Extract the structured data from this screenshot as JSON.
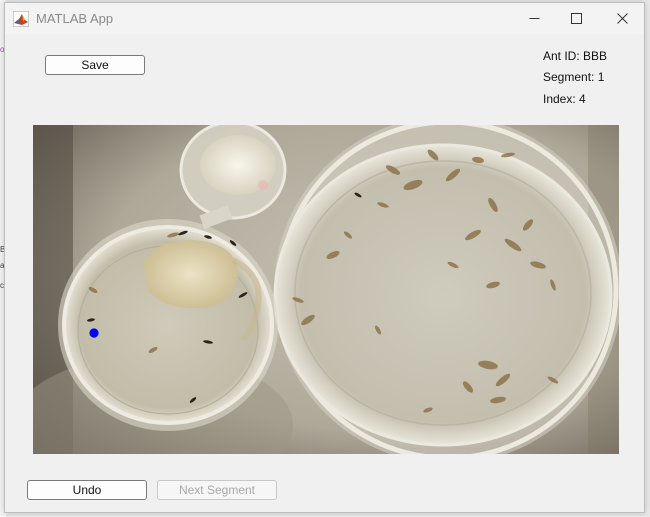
{
  "window": {
    "title": "MATLAB App",
    "controls": [
      "minimize-icon",
      "maximize-icon",
      "close-icon"
    ]
  },
  "toolbar": {
    "save_label": "Save"
  },
  "info": {
    "ant_id": "Ant ID: BBB",
    "segment": "Segment: 1",
    "index": "Index: 4"
  },
  "footer": {
    "undo_label": "Undo",
    "next_segment_label": "Next Segment",
    "next_segment_enabled": false
  },
  "image": {
    "description_icon": "petri-dish-photo",
    "marker_color": "#0000ff"
  },
  "colors": {
    "window_bg": "#f0f0f0",
    "title_text": "#8a8a8a"
  }
}
